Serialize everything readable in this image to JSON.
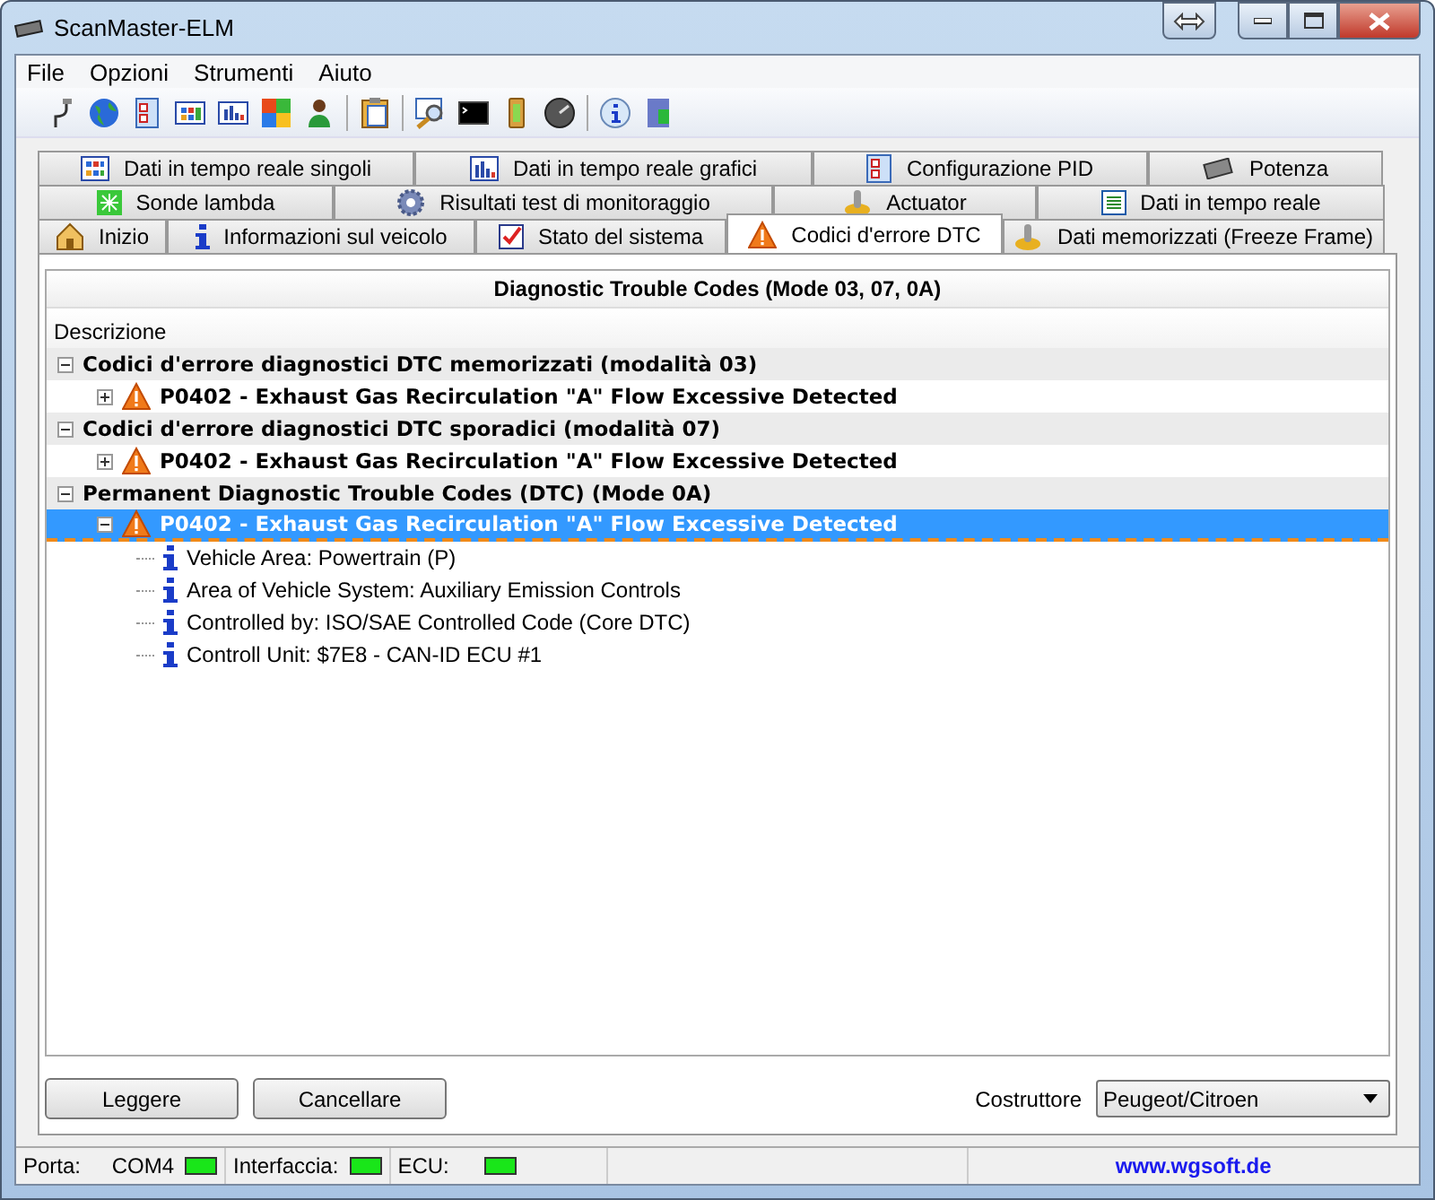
{
  "window": {
    "title": "ScanMaster-ELM"
  },
  "menu": [
    "File",
    "Opzioni",
    "Strumenti",
    "Aiuto"
  ],
  "tab_rows": [
    [
      {
        "label": "Dati in tempo reale singoli",
        "selected": false
      },
      {
        "label": "Dati in tempo reale grafici",
        "selected": false
      },
      {
        "label": "Configurazione PID",
        "selected": false
      },
      {
        "label": "Potenza",
        "selected": false
      }
    ],
    [
      {
        "label": "Sonde lambda",
        "selected": false
      },
      {
        "label": "Risultati test di monitoraggio",
        "selected": false
      },
      {
        "label": "Actuator",
        "selected": false
      },
      {
        "label": "Dati in tempo reale",
        "selected": false
      }
    ],
    [
      {
        "label": "Inizio",
        "selected": false
      },
      {
        "label": "Informazioni sul veicolo",
        "selected": false
      },
      {
        "label": "Stato del sistema",
        "selected": false
      },
      {
        "label": "Codici d'errore DTC",
        "selected": true
      },
      {
        "label": "Dati memorizzati (Freeze Frame)",
        "selected": false
      }
    ]
  ],
  "panel": {
    "title": "Diagnostic Trouble Codes (Mode 03, 07, 0A)",
    "column": "Descrizione"
  },
  "tree": [
    {
      "label": "Codici d'errore diagnostici DTC memorizzati (modalità 03)",
      "expanded": true,
      "selected": false,
      "children": [
        {
          "label": "P0402 - Exhaust Gas Recirculation \"A\" Flow Excessive Detected",
          "expanded": false,
          "selected": false
        }
      ]
    },
    {
      "label": "Codici d'errore diagnostici DTC sporadici (modalità 07)",
      "expanded": true,
      "selected": false,
      "children": [
        {
          "label": "P0402 - Exhaust Gas Recirculation \"A\" Flow Excessive Detected",
          "expanded": false,
          "selected": false
        }
      ]
    },
    {
      "label": "Permanent Diagnostic Trouble Codes (DTC) (Mode 0A)",
      "expanded": true,
      "selected": false,
      "children": [
        {
          "label": "P0402 - Exhaust Gas Recirculation \"A\" Flow Excessive Detected",
          "expanded": true,
          "selected": true,
          "children": [
            {
              "label": "Vehicle Area: Powertrain (P)",
              "selected": false
            },
            {
              "label": "Area of Vehicle System: Auxiliary Emission Controls",
              "selected": false
            },
            {
              "label": "Controlled by: ISO/SAE Controlled Code (Core DTC)",
              "selected": false
            },
            {
              "label": "Controll Unit: $7E8 - CAN-ID ECU #1",
              "selected": false
            }
          ]
        }
      ]
    }
  ],
  "buttons": [
    "Leggere",
    "Cancellare"
  ],
  "manufacturer": {
    "label": "Costruttore",
    "value": "Peugeot/Citroen"
  },
  "status_bar": {
    "port_label": "Porta:",
    "port": "COM4",
    "port_on": true,
    "interface_label": "Interfaccia:",
    "interface_on": true,
    "ecu_label": "ECU:",
    "ecu_on": true,
    "link": "www.wgsoft.de"
  }
}
